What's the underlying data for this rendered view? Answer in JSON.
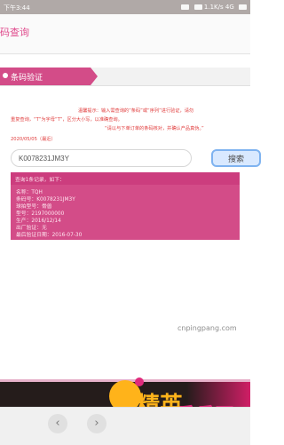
{
  "status_bar": {
    "time": "下午3:44",
    "right_text": "1.1K/s 4G"
  },
  "header": {
    "title": "码查询"
  },
  "section": {
    "title": "条码验证"
  },
  "notices": {
    "line1": "温馨提示：输入需查询的“条码”或“序列”进行验证，请勿",
    "line2": "重复查询，“T”为字母“T”，区分大小写，以准确查询。",
    "line3": "“请以与下单订单的条码核对，并确认产品真伪。”",
    "date": "2020/05/05（最近）"
  },
  "search": {
    "value": "K0078231JM3Y",
    "button_label": "搜索"
  },
  "result": {
    "header": "查询1条记录，如下：",
    "lines": [
      "名称：TQH",
      "条码号：K0078231JM3Y",
      "球拍型号：骨兽",
      "型号：2197000000",
      "生产：2016/12/14",
      "出厂验证：无",
      "最后验证日期：2016-07-30"
    ]
  },
  "watermark": {
    "url": "cnpingpang.com",
    "logo_part1": "精英",
    "logo_part2": "乒乓网"
  },
  "nav": {
    "back": "‹",
    "forward": "›"
  }
}
